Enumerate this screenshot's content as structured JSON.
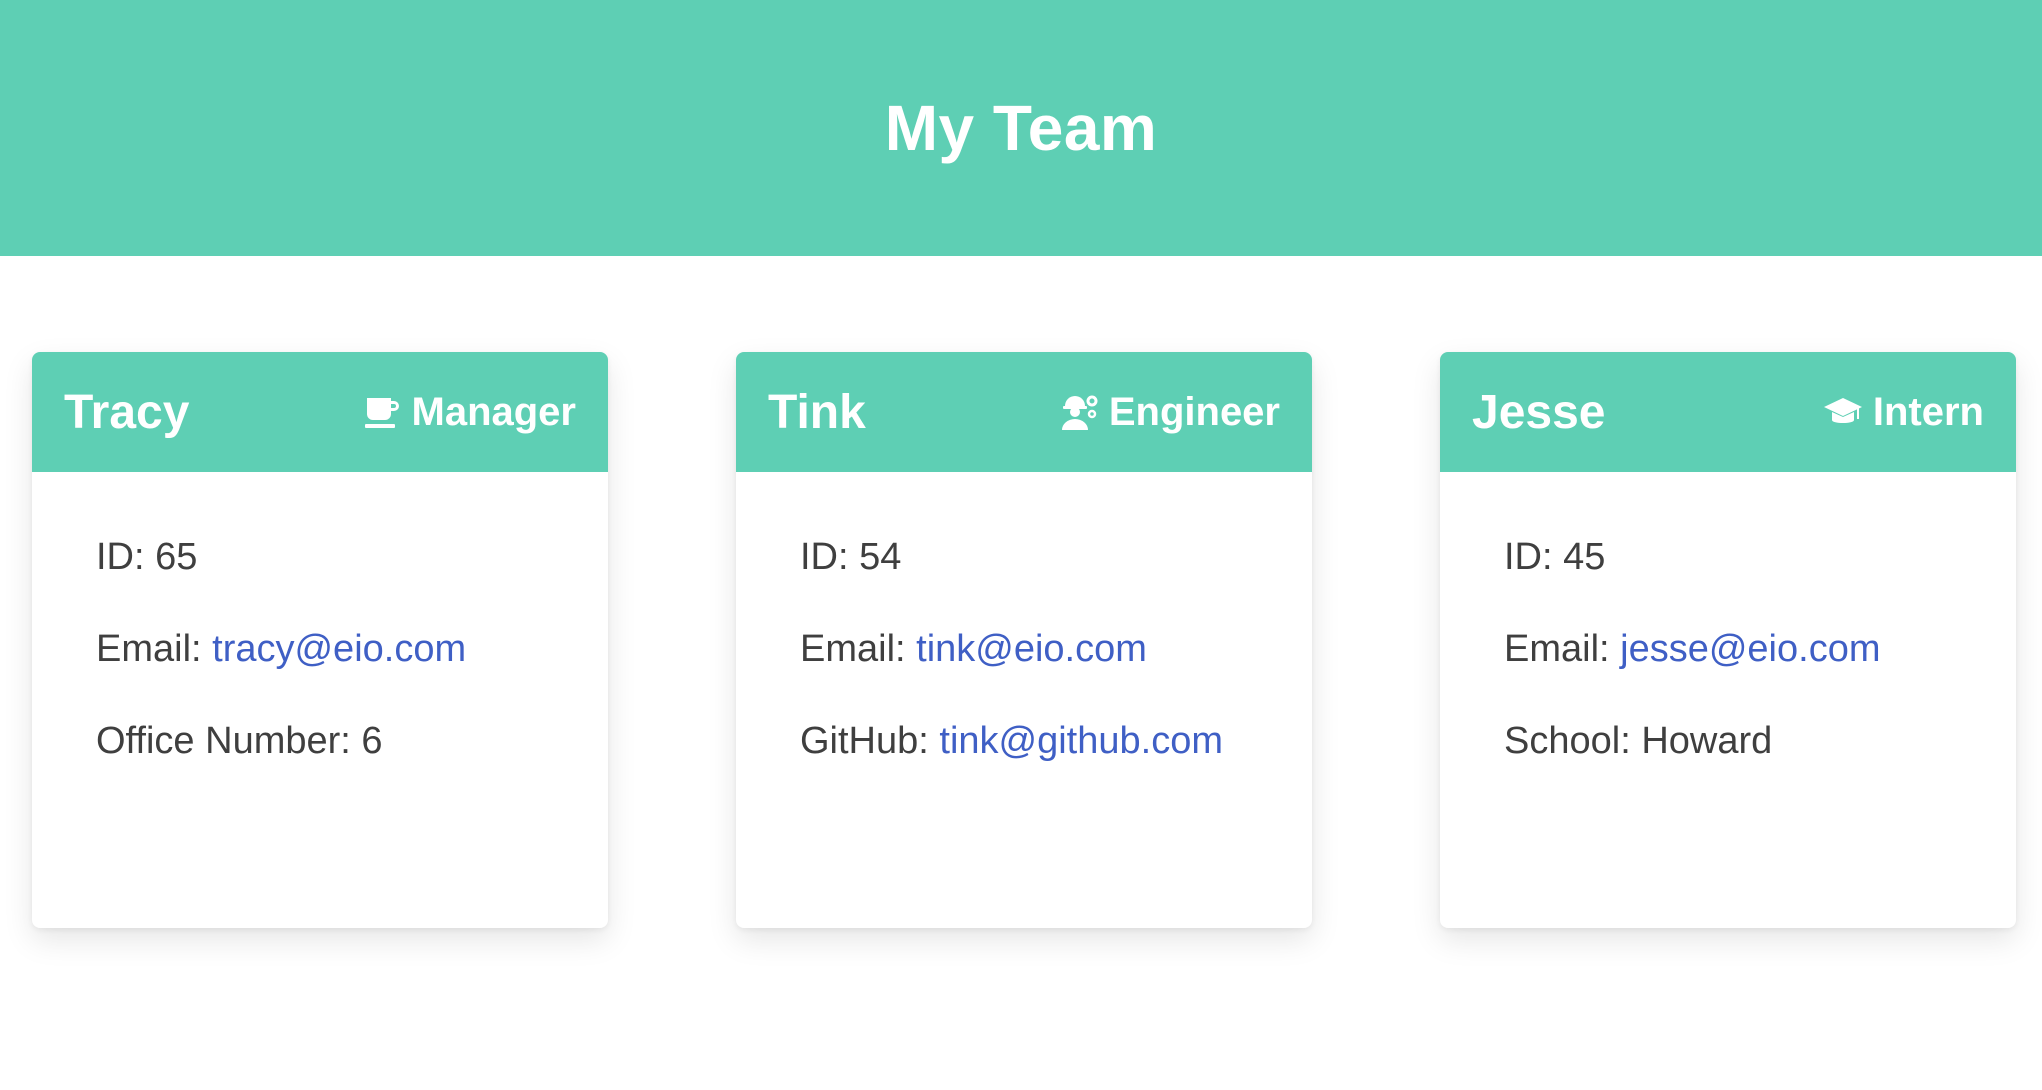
{
  "header": {
    "title": "My Team"
  },
  "colors": {
    "accent": "#5ecfb4",
    "link": "#3f5fc5",
    "text": "#3f3f3f"
  },
  "team": [
    {
      "name": "Tracy",
      "role": "Manager",
      "icon": "coffee-mug-icon",
      "id_label": "ID: ",
      "id": "65",
      "email_label": "Email: ",
      "email": "tracy@eio.com",
      "extra_label": "Office Number: ",
      "extra_value": "6"
    },
    {
      "name": "Tink",
      "role": "Engineer",
      "icon": "engineer-cog-icon",
      "id_label": "ID: ",
      "id": "54",
      "email_label": "Email: ",
      "email": "tink@eio.com",
      "extra_label": "GitHub: ",
      "extra_value": "tink@github.com"
    },
    {
      "name": "Jesse",
      "role": "Intern",
      "icon": "graduation-cap-icon",
      "id_label": "ID: ",
      "id": "45",
      "email_label": "Email: ",
      "email": "jesse@eio.com",
      "extra_label": "School: ",
      "extra_value": "Howard"
    }
  ]
}
